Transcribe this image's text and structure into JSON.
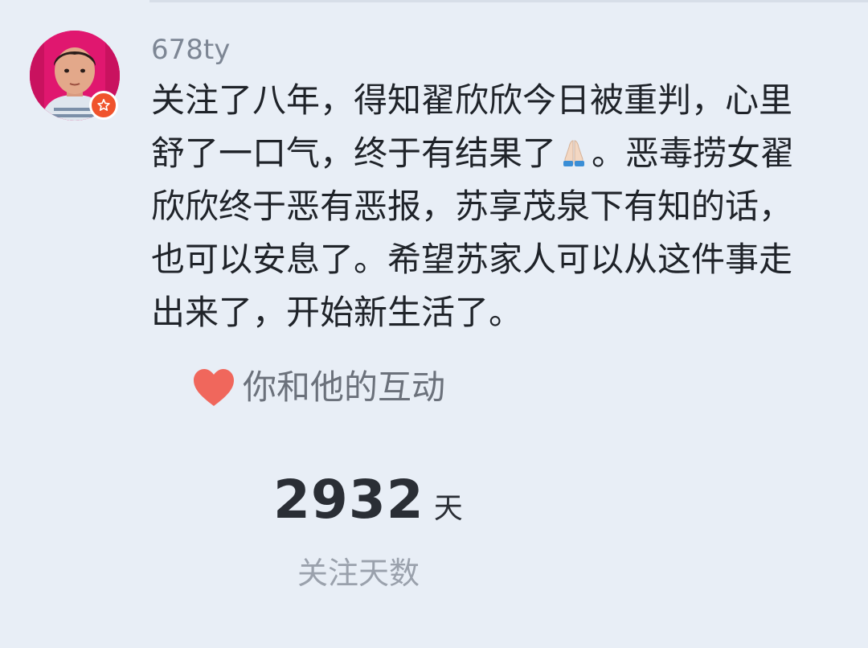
{
  "comment": {
    "username": "678ty",
    "lines": [
      "关注了八年，得知翟欣欣今日被重判，心里",
      "舒了一口气，终于有结果了",
      "。恶毒捞女翟",
      "欣欣终于恶有恶报，苏享茂泉下有知的话，",
      "也可以安息了。希望苏家人可以从这件事走",
      "出来了，开始新生活了。"
    ],
    "emoji": "praying-hands-icon",
    "badge_icon": "star-icon"
  },
  "interaction": {
    "label": "你和他的互动",
    "icon": "heart-icon",
    "heart_color": "#f0675c"
  },
  "stats": {
    "days_value": "2932",
    "days_unit": "天",
    "days_label": "关注天数"
  },
  "colors": {
    "background": "#e8eef6",
    "badge": "#f0532c",
    "avatar_bg": "#e0176f"
  }
}
